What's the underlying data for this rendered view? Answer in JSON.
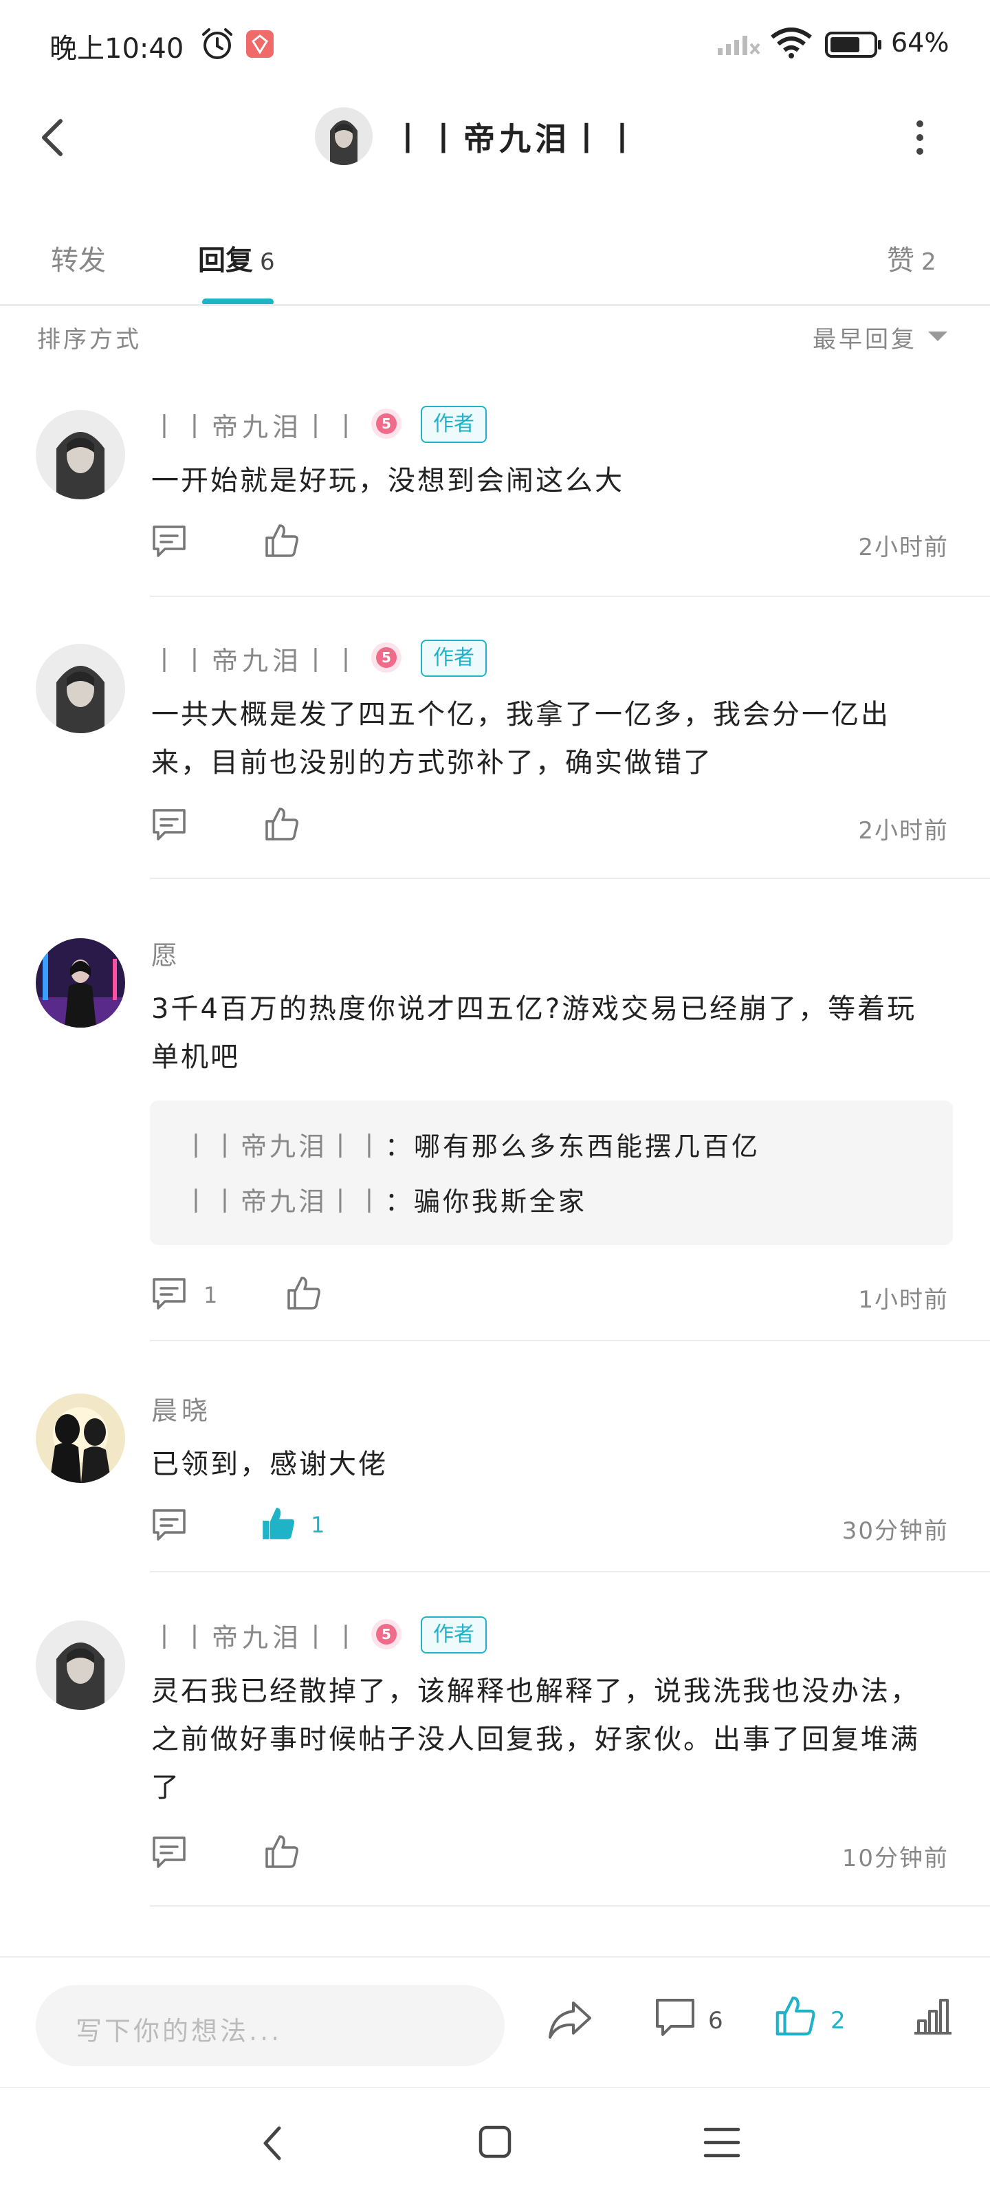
{
  "status_bar": {
    "time": "晚上10:40",
    "battery_text": "64%",
    "icons": [
      "alarm-icon",
      "app-notification-icon",
      "signal-icon",
      "wifi-icon",
      "battery-icon"
    ]
  },
  "header": {
    "title": "丨丨帝九泪丨丨",
    "icons": [
      "back-arrow-icon",
      "more-icon"
    ]
  },
  "tabs": [
    {
      "label": "转发",
      "count": ""
    },
    {
      "label": "回复",
      "count": "6"
    },
    {
      "label": "赞",
      "count": "2"
    }
  ],
  "sort": {
    "label": "排序方式",
    "value": "最早回复"
  },
  "comments": [
    {
      "name": "丨丨帝九泪丨丨",
      "author_badge": "作者",
      "lines": [
        "一开始就是好玩，没想到会闹这么大"
      ],
      "time": "2小时前",
      "reply_count": "",
      "like_count": ""
    },
    {
      "name": "丨丨帝九泪丨丨",
      "author_badge": "作者",
      "lines": [
        "一共大概是发了四五个亿，我拿了一亿多，我会分一亿出",
        "来，目前也没别的方式弥补了，确实做错了"
      ],
      "time": "2小时前",
      "reply_count": "",
      "like_count": ""
    },
    {
      "name": "愿",
      "lines": [
        "3千4百万的热度你说才四五亿?游戏交易已经崩了，等着玩",
        "单机吧"
      ],
      "sub_replies": [
        {
          "name": "丨丨帝九泪丨丨",
          "text": "：哪有那么多东西能摆几百亿"
        },
        {
          "name": "丨丨帝九泪丨丨",
          "text": "：骗你我斯全家"
        }
      ],
      "time": "1小时前",
      "reply_count": "1",
      "like_count": ""
    },
    {
      "name": "晨晓",
      "lines": [
        "已领到，感谢大佬"
      ],
      "time": "30分钟前",
      "reply_count": "",
      "like_count": "1",
      "liked": true
    },
    {
      "name": "丨丨帝九泪丨丨",
      "author_badge": "作者",
      "lines": [
        "灵石我已经散掉了，该解释也解释了，说我洗我也没办法，",
        "之前做好事时候帖子没人回复我，好家伙。出事了回复堆满",
        "了"
      ],
      "time": "10分钟前",
      "reply_count": "",
      "like_count": ""
    }
  ],
  "bottom_bar": {
    "input_placeholder": "写下你的想法...",
    "comment_count": "6",
    "like_count": "2",
    "icons": [
      "share-icon",
      "comment-icon",
      "like-icon",
      "stats-icon"
    ]
  },
  "nav_bar": {
    "icons": [
      "nav-back-icon",
      "nav-home-icon",
      "nav-menu-icon"
    ]
  },
  "colors": {
    "accent": "#1fb3c8",
    "secondary_text": "#888888",
    "badge_pink": "#f06a8a"
  }
}
